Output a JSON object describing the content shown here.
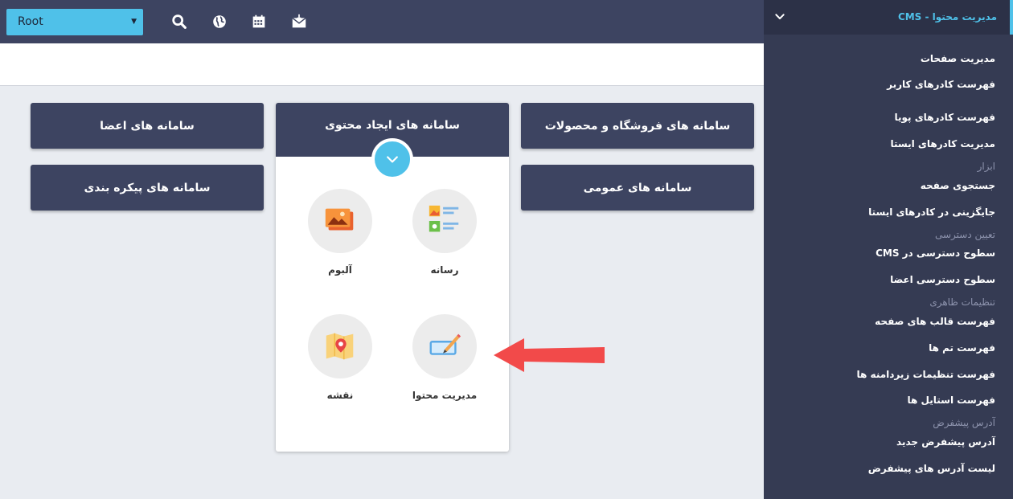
{
  "toolbar": {
    "root_select_value": "Root",
    "icons": [
      "search-icon",
      "globe-icon",
      "calendar-icon",
      "mail-icon"
    ]
  },
  "cards": {
    "members": "سامانه های اعضا",
    "content_creation": "سامانه های ایجاد محتوی",
    "shop_products": "سامانه های فروشگاه و محصولات",
    "configuration": "سامانه های پیکره بندی",
    "general": "سامانه های عمومی"
  },
  "content_modules": [
    {
      "label": "رسانه",
      "icon": "media-icon"
    },
    {
      "label": "آلبوم",
      "icon": "album-icon"
    },
    {
      "label": "مدیریت محتوا",
      "icon": "content-edit-icon"
    },
    {
      "label": "نقشه",
      "icon": "map-icon"
    }
  ],
  "sidebar": {
    "header": "مدیریت محتوا - CMS",
    "items": [
      {
        "label": "مدیریت صفحات"
      },
      {
        "label": "فهرست کادرهای کاربر"
      },
      {
        "label": "فهرست کادرهای پویا"
      },
      {
        "label": "مدیریت کادرهای ایستا"
      },
      {
        "label": "جستجوی صفحه"
      },
      {
        "label": "جایگزینی در کادرهای ایستا"
      },
      {
        "label": "سطوح دسترسی در CMS"
      },
      {
        "label": "سطوح دسترسی اعضا"
      },
      {
        "label": "فهرست قالب های صفحه"
      },
      {
        "label": "فهرست تم ها"
      },
      {
        "label": "فهرست تنظیمات زیردامنه ها"
      },
      {
        "label": "فهرست استایل ها"
      },
      {
        "label": "آدرس پیشفرض جدید"
      },
      {
        "label": "لیست آدرس های پیشفرض"
      }
    ],
    "groups": {
      "tools": "ابزار",
      "access": "تعیین دسترسی",
      "appearance": "تنظیمات ظاهری",
      "default_address": "آدرس پیشفرض"
    }
  },
  "colors": {
    "navy": "#3d4461",
    "sidebar": "#353b53",
    "accent": "#4fc1e9",
    "arrow": "#f24a4a"
  }
}
